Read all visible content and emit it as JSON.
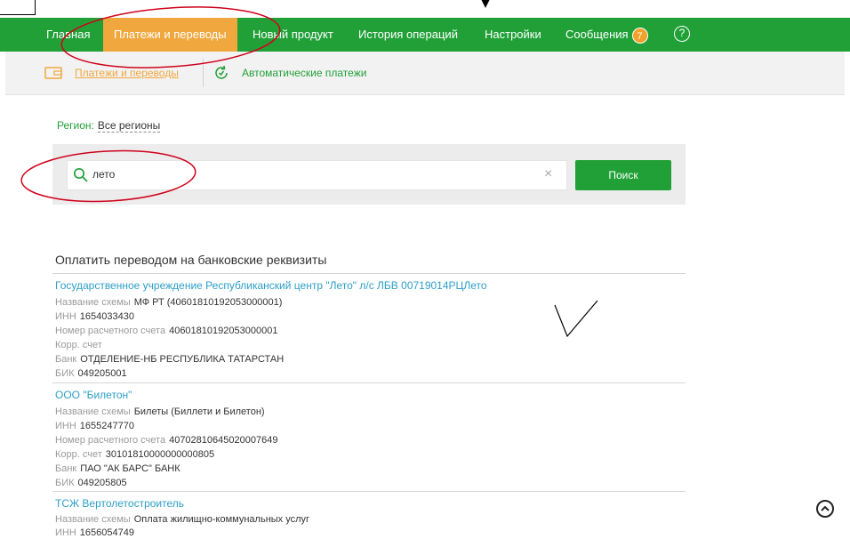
{
  "nav": {
    "items": [
      "Главная",
      "Платежи и переводы",
      "Новый продукт",
      "История операций",
      "Настройки",
      "Сообщения"
    ],
    "messages_count": "7",
    "help_glyph": "?",
    "color": "#21a038",
    "active_color": "#f0a83e"
  },
  "subnav": {
    "payments": "Платежи и переводы",
    "auto": "Автоматические платежи"
  },
  "region": {
    "label": "Регион:",
    "value": "Все регионы"
  },
  "search": {
    "value": "лето",
    "button": "Поиск",
    "clear_glyph": "×"
  },
  "section_title": "Оплатить переводом на банковские реквизиты",
  "entries": [
    {
      "title": "Государственное учреждение Республиканский центр \"Лето\" л/с ЛБВ 00719014РЦЛето",
      "rows": [
        {
          "k": "Название схемы",
          "v": "МФ РТ (40601810192053000001)"
        },
        {
          "k": "ИНН",
          "v": "1654033430"
        },
        {
          "k": "Номер расчетного счета",
          "v": "40601810192053000001"
        },
        {
          "k": "Корр. счет",
          "v": ""
        },
        {
          "k": "Банк",
          "v": "ОТДЕЛЕНИЕ-НБ РЕСПУБЛИКА ТАТАРСТАН"
        },
        {
          "k": "БИК",
          "v": "049205001"
        }
      ]
    },
    {
      "title": "ООО \"Билетон\"",
      "rows": [
        {
          "k": "Название схемы",
          "v": "Билеты (Биллети и Билетон)"
        },
        {
          "k": "ИНН",
          "v": "1655247770"
        },
        {
          "k": "Номер расчетного счета",
          "v": "40702810645020007649"
        },
        {
          "k": "Корр. счет",
          "v": "30101810000000000805"
        },
        {
          "k": "Банк",
          "v": "ПАО \"АК БАРС\" БАНК"
        },
        {
          "k": "БИК",
          "v": "049205805"
        }
      ]
    },
    {
      "title": "ТСЖ Вертолетостроитель",
      "rows": [
        {
          "k": "Название схемы",
          "v": "Оплата жилищно-коммунальных услуг"
        },
        {
          "k": "ИНН",
          "v": "1656054749"
        }
      ]
    }
  ]
}
